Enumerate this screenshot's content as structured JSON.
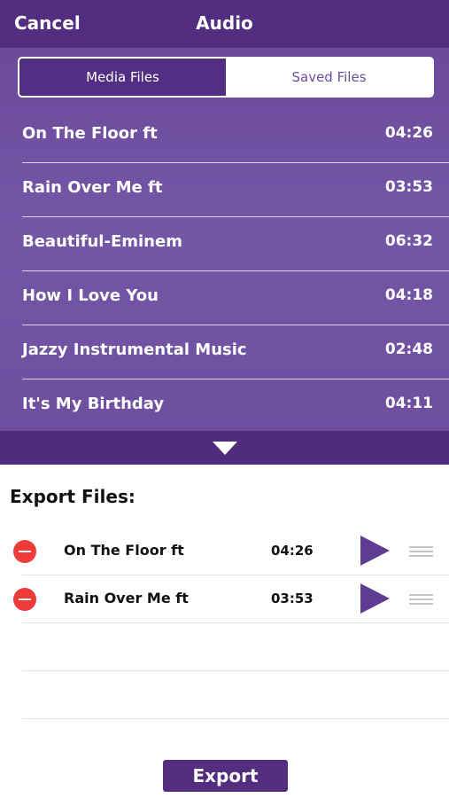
{
  "nav": {
    "cancel_label": "Cancel",
    "title": "Audio"
  },
  "tabs": {
    "media_files": "Media Files",
    "saved_files": "Saved Files",
    "selected": "Media Files"
  },
  "tracks": [
    {
      "name": "On The Floor ft",
      "duration": "04:26"
    },
    {
      "name": "Rain Over Me ft",
      "duration": "03:53"
    },
    {
      "name": "Beautiful-Eminem",
      "duration": "06:32"
    },
    {
      "name": "How I Love You",
      "duration": "04:18"
    },
    {
      "name": "Jazzy Instrumental Music",
      "duration": "02:48"
    },
    {
      "name": "It's My Birthday",
      "duration": "04:11"
    }
  ],
  "export": {
    "heading": "Export Files:",
    "items": [
      {
        "name": "On The Floor ft",
        "duration": "04:26"
      },
      {
        "name": "Rain Over Me ft",
        "duration": "03:53"
      }
    ],
    "button_label": "Export"
  },
  "icons": {
    "collapse": "chevron-down-icon",
    "remove": "remove-minus-icon",
    "play": "play-icon",
    "reorder": "drag-handle-icon"
  },
  "colors": {
    "primary": "#522d80",
    "panel": "#7456a7",
    "remove": "#ef3a3a",
    "play": "#5e3c92"
  }
}
